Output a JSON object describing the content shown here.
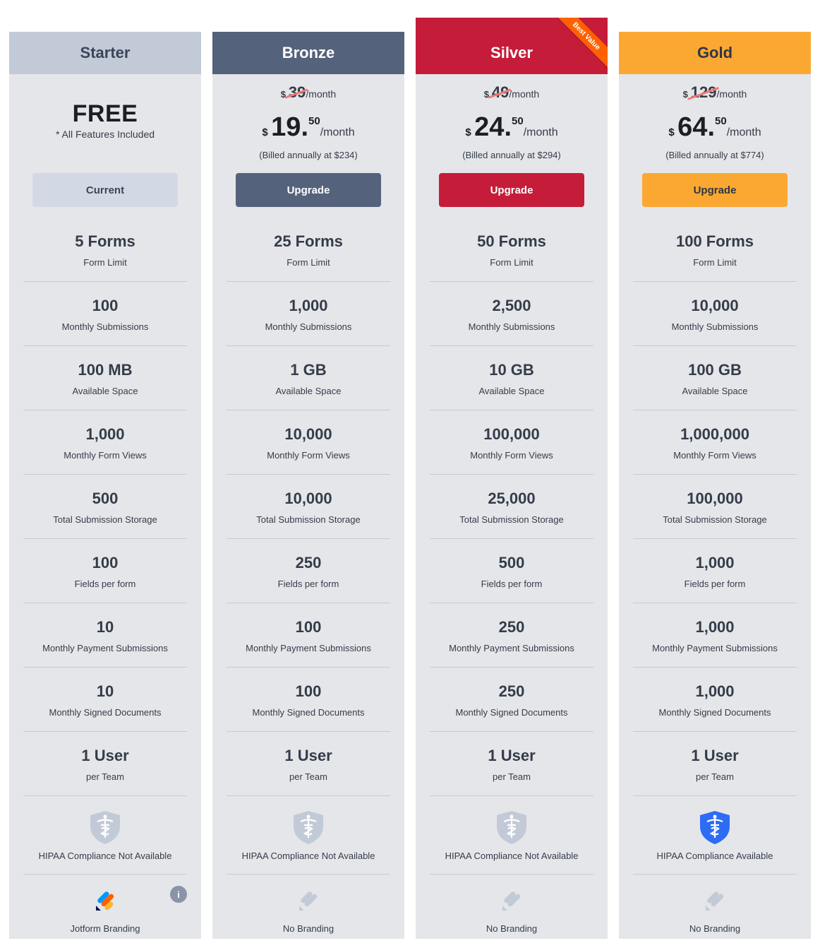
{
  "colors": {
    "starter_header": "#c3cad7",
    "bronze_header": "#55627c",
    "silver_header": "#c51c3a",
    "gold_header": "#fba832",
    "ribbon": "#ff6100",
    "hipaa_available": "#2e6cf6",
    "hipaa_unavailable": "#c3cad7"
  },
  "plans": [
    {
      "name": "Starter",
      "free_label": "FREE",
      "free_note": "* All Features Included",
      "button": "Current",
      "features": [
        {
          "value": "5 Forms",
          "label": "Form Limit"
        },
        {
          "value": "100",
          "label": "Monthly Submissions"
        },
        {
          "value": "100 MB",
          "label": "Available Space"
        },
        {
          "value": "1,000",
          "label": "Monthly Form Views"
        },
        {
          "value": "500",
          "label": "Total Submission Storage"
        },
        {
          "value": "100",
          "label": "Fields per form"
        },
        {
          "value": "10",
          "label": "Monthly Payment Submissions"
        },
        {
          "value": "10",
          "label": "Monthly Signed Documents"
        },
        {
          "value": "1 User",
          "label": "per Team"
        }
      ],
      "hipaa": {
        "label": "HIPAA Compliance Not Available",
        "icon": "shield-caduceus-icon",
        "available": false
      },
      "branding": {
        "label": "Jotform Branding",
        "icon": "jotform-logo-icon",
        "info_icon": "i"
      }
    },
    {
      "name": "Bronze",
      "old_price": {
        "currency": "$",
        "amount": "39",
        "period": "/month"
      },
      "price": {
        "currency": "$",
        "integer": "19.",
        "cents": "50",
        "period": "/month"
      },
      "billed": "(Billed annually at $234)",
      "button": "Upgrade",
      "features": [
        {
          "value": "25 Forms",
          "label": "Form Limit"
        },
        {
          "value": "1,000",
          "label": "Monthly Submissions"
        },
        {
          "value": "1 GB",
          "label": "Available Space"
        },
        {
          "value": "10,000",
          "label": "Monthly Form Views"
        },
        {
          "value": "10,000",
          "label": "Total Submission Storage"
        },
        {
          "value": "250",
          "label": "Fields per form"
        },
        {
          "value": "100",
          "label": "Monthly Payment Submissions"
        },
        {
          "value": "100",
          "label": "Monthly Signed Documents"
        },
        {
          "value": "1 User",
          "label": "per Team"
        }
      ],
      "hipaa": {
        "label": "HIPAA Compliance Not Available",
        "icon": "shield-caduceus-icon",
        "available": false
      },
      "branding": {
        "label": "No Branding",
        "icon": "jotform-logo-gray-icon"
      }
    },
    {
      "name": "Silver",
      "ribbon": "Best Value",
      "old_price": {
        "currency": "$",
        "amount": "49",
        "period": "/month"
      },
      "price": {
        "currency": "$",
        "integer": "24.",
        "cents": "50",
        "period": "/month"
      },
      "billed": "(Billed annually at $294)",
      "button": "Upgrade",
      "features": [
        {
          "value": "50 Forms",
          "label": "Form Limit"
        },
        {
          "value": "2,500",
          "label": "Monthly Submissions"
        },
        {
          "value": "10 GB",
          "label": "Available Space"
        },
        {
          "value": "100,000",
          "label": "Monthly Form Views"
        },
        {
          "value": "25,000",
          "label": "Total Submission Storage"
        },
        {
          "value": "500",
          "label": "Fields per form"
        },
        {
          "value": "250",
          "label": "Monthly Payment Submissions"
        },
        {
          "value": "250",
          "label": "Monthly Signed Documents"
        },
        {
          "value": "1 User",
          "label": "per Team"
        }
      ],
      "hipaa": {
        "label": "HIPAA Compliance Not Available",
        "icon": "shield-caduceus-icon",
        "available": false
      },
      "branding": {
        "label": "No Branding",
        "icon": "jotform-logo-gray-icon"
      }
    },
    {
      "name": "Gold",
      "old_price": {
        "currency": "$",
        "amount": "129",
        "period": "/month"
      },
      "price": {
        "currency": "$",
        "integer": "64.",
        "cents": "50",
        "period": "/month"
      },
      "billed": "(Billed annually at $774)",
      "button": "Upgrade",
      "features": [
        {
          "value": "100 Forms",
          "label": "Form Limit"
        },
        {
          "value": "10,000",
          "label": "Monthly Submissions"
        },
        {
          "value": "100 GB",
          "label": "Available Space"
        },
        {
          "value": "1,000,000",
          "label": "Monthly Form Views"
        },
        {
          "value": "100,000",
          "label": "Total Submission Storage"
        },
        {
          "value": "1,000",
          "label": "Fields per form"
        },
        {
          "value": "1,000",
          "label": "Monthly Payment Submissions"
        },
        {
          "value": "1,000",
          "label": "Monthly Signed Documents"
        },
        {
          "value": "1 User",
          "label": "per Team"
        }
      ],
      "hipaa": {
        "label": "HIPAA Compliance Available",
        "icon": "shield-caduceus-icon",
        "available": true
      },
      "branding": {
        "label": "No Branding",
        "icon": "jotform-logo-gray-icon"
      }
    }
  ]
}
